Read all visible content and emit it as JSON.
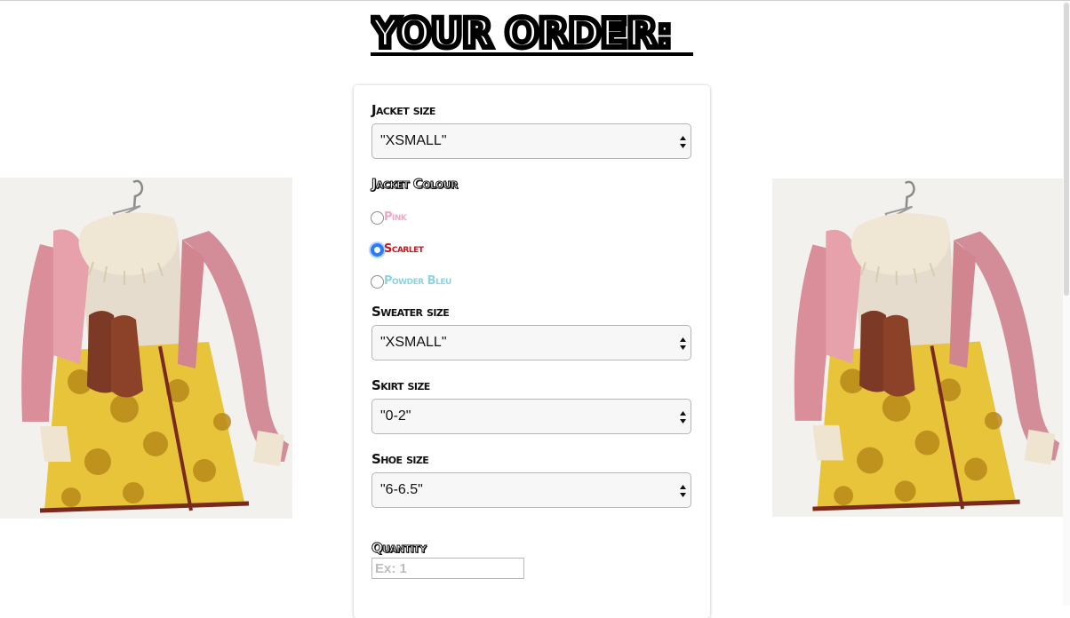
{
  "page": {
    "title": "YOUR ORDER:"
  },
  "form": {
    "jacket_size": {
      "label": "Jacket size",
      "value": "\"XSMALL\""
    },
    "jacket_colour": {
      "label": "Jacket Colour",
      "options": [
        {
          "label": "Pink",
          "color": "#f1a6c9",
          "checked": false
        },
        {
          "label": "Scarlet",
          "color": "#c4191f",
          "checked": true
        },
        {
          "label": "Powder Bleu",
          "color": "#8fd2df",
          "checked": false
        }
      ]
    },
    "sweater_size": {
      "label": "Sweater size",
      "value": "\"XSMALL\""
    },
    "skirt_size": {
      "label": "Skirt size",
      "value": "\"0-2\""
    },
    "shoe_size": {
      "label": "Shoe size",
      "value": "\"6-6.5\""
    },
    "quantity": {
      "label": "Quantity",
      "placeholder": "Ex: 1",
      "value": ""
    }
  },
  "images": [
    {
      "icon": "outfit-photo",
      "description_name": "outfit-image-left"
    },
    {
      "icon": "outfit-photo",
      "description_name": "outfit-image-right"
    }
  ],
  "colors": {
    "focus": "#2b7bf3",
    "ink": "#111111"
  }
}
